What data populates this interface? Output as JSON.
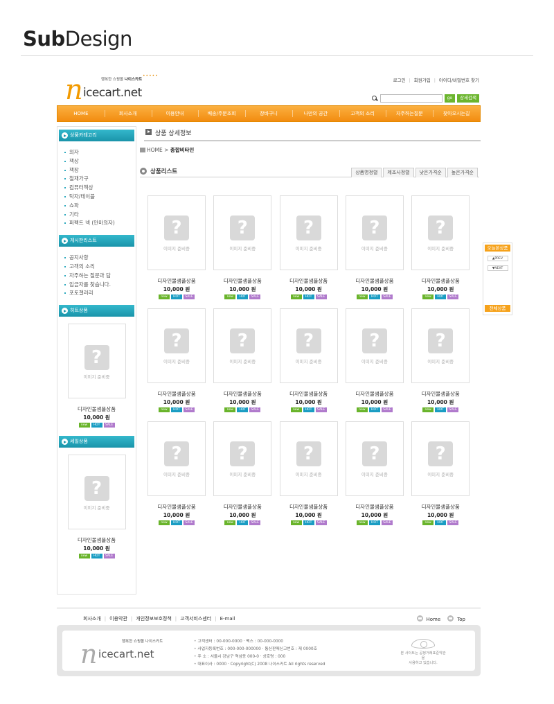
{
  "hero": {
    "bold": "Sub",
    "light": "Design"
  },
  "logo": {
    "tagline_prefix": "행복한 쇼핑몰",
    "tagline_brand": "나이스카트",
    "letter": "n",
    "word": "icecart.net"
  },
  "top_links": [
    "로그인",
    "회원가입",
    "아이디/비밀번호 찾기"
  ],
  "search": {
    "placeholder": "",
    "go": "go",
    "detail": "상세검색"
  },
  "nav": [
    "HOME",
    "회사소개",
    "이용안내",
    "배송/주문조회",
    "장바구니",
    "나만의 공간",
    "고객의 소리",
    "자주하는질문",
    "찾아오시는길"
  ],
  "sidebar": {
    "categories_title": "상품카테고리",
    "categories": [
      "의자",
      "책상",
      "책장",
      "철재가구",
      "컴퓨터책상",
      "탁자/테이블",
      "쇼파",
      "기타",
      "퍼펙트 넥 (안마의자)"
    ],
    "board_title": "게시판리스트",
    "boards": [
      "공지사항",
      "고객의 소리",
      "자주하는 질문과 답",
      "입금자를 찾습니다.",
      "포토갤러리"
    ],
    "hit_title": "히트상품",
    "sale_title": "세일상품"
  },
  "product": {
    "name": "디자인몰샘플상품",
    "price": "10,000 원",
    "image_label": "이미지 준비중",
    "badges": [
      "new",
      "HOT",
      "SALE"
    ]
  },
  "main": {
    "title": "상품 상세정보",
    "breadcrumb_home": "HOME >",
    "breadcrumb_current": "종합비타민",
    "list_title": "상품리스트",
    "sort_tabs": [
      "상품명정렬",
      "제조사정렬",
      "낮은가격순",
      "높은가격순"
    ]
  },
  "today": {
    "title": "오늘본상품",
    "prev": "▲PREV",
    "next": "▼NEXT",
    "all": "전체상품"
  },
  "footer": {
    "links": [
      "회사소개",
      "이용약관",
      "개인정보보호정책",
      "고객서비스센터",
      "E-mail"
    ],
    "home": "Home",
    "top": "Top",
    "logo_tagline": "행복한 쇼핑몰 나이스카트",
    "logo_letter": "n",
    "logo_word": "icecart.net",
    "info_lines": [
      "고객센터 : 00-000-0000  ·  팩스 : 00-000-0000",
      "사업자등록번호 : 000-000-000000  ·  통신판매신고번호 : 제 0000호",
      "주 소 : 서울시 강남구 역삼동 000-0  ·  상호명 : 000",
      "대표이사 : 0000  ·  Copyright(C) 2008 나이스카트 All rights reserved"
    ],
    "mark_text_1": "본 사이트는 공정거래표준약관을",
    "mark_text_2": "사용하고 있습니다."
  }
}
